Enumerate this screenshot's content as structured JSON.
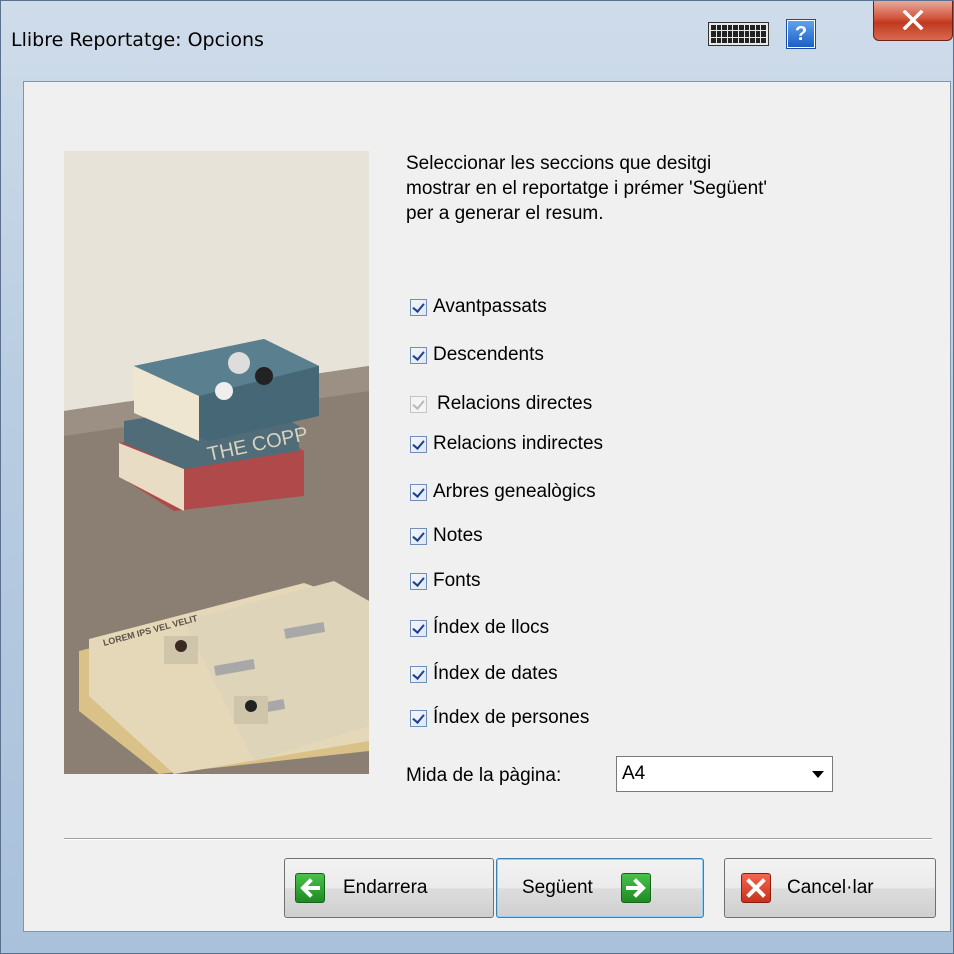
{
  "window": {
    "title": "Llibre Reportatge: Opcions"
  },
  "instructions": "Seleccionar les seccions que desitgi\nmostrar en el reportatge i prémer 'Següent'\nper a generar el resum.",
  "options": [
    {
      "label": "Avantpassats",
      "checked": true,
      "enabled": true
    },
    {
      "label": "Descendents",
      "checked": true,
      "enabled": true
    },
    {
      "label": "Relacions directes",
      "checked": true,
      "enabled": false
    },
    {
      "label": "Relacions indirectes",
      "checked": true,
      "enabled": true
    },
    {
      "label": "Arbres genealògics",
      "checked": true,
      "enabled": true
    },
    {
      "label": "Notes",
      "checked": true,
      "enabled": true
    },
    {
      "label": "Fonts",
      "checked": true,
      "enabled": true
    },
    {
      "label": "Índex de llocs",
      "checked": true,
      "enabled": true
    },
    {
      "label": "Índex de dates",
      "checked": true,
      "enabled": true
    },
    {
      "label": "Índex de persones",
      "checked": true,
      "enabled": true
    }
  ],
  "page_size": {
    "label": "Mida de la pàgina:",
    "value": "A4"
  },
  "buttons": {
    "back": "Endarrera",
    "next": "Següent",
    "cancel": "Cancel·lar"
  },
  "illustration": {
    "book_spine_text": "THE COPP",
    "document_text": "LOREM IPS VEL VELIT"
  },
  "colors": {
    "accent_green": "#2a9b2f",
    "cancel_red": "#d9412a",
    "title_gradient": "#b9cde2"
  }
}
